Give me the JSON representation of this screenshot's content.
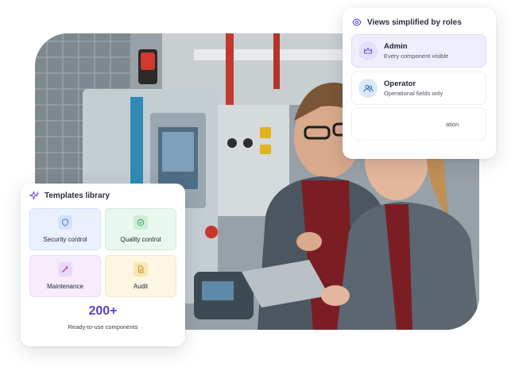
{
  "photo": {
    "alt": ""
  },
  "roles_card": {
    "title": "Views simplified by roles",
    "icon": "eye-icon",
    "roles": [
      {
        "name": "Admin",
        "description": "Every component visible",
        "icon": "crown-icon"
      },
      {
        "name": "Operator",
        "description": "Operational fields only",
        "icon": "users-icon"
      },
      {
        "name": "",
        "description": "ation",
        "icon": ""
      }
    ]
  },
  "templates_card": {
    "title": "Templates library",
    "icon": "sparkles-icon",
    "tiles": [
      {
        "label": "Security control",
        "icon": "shield-icon",
        "color": "#3b6fd8"
      },
      {
        "label": "Quality control",
        "icon": "check-circle-icon",
        "color": "#2f9e55"
      },
      {
        "label": "Maintenance",
        "icon": "wrench-icon",
        "color": "#a23bc9"
      },
      {
        "label": "Audit",
        "icon": "document-icon",
        "color": "#c98b12"
      }
    ],
    "count": "200+",
    "count_label": "Ready-to-use components"
  },
  "colors": {
    "accent": "#5b3fd6",
    "admin_bg": "#efeefe",
    "operator_icon_bg": "#dceaf8"
  }
}
